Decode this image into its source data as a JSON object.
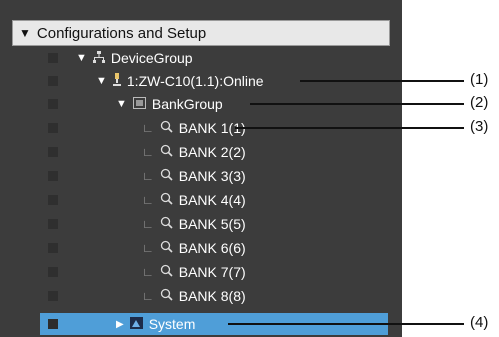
{
  "panel": {
    "header": "Configurations and Setup"
  },
  "tree": {
    "device_group": "DeviceGroup",
    "device": "1:ZW-C10(1.1):Online",
    "bank_group": "BankGroup",
    "banks": [
      "BANK 1(1)",
      "BANK 2(2)",
      "BANK 3(3)",
      "BANK 4(4)",
      "BANK 5(5)",
      "BANK 6(6)",
      "BANK 7(7)",
      "BANK 8(8)"
    ],
    "system": "System"
  },
  "callouts": [
    "(1)",
    "(2)",
    "(3)",
    "(4)"
  ],
  "colors": {
    "panel_bg": "#3c3c3c",
    "selected_row": "#4f9ed8",
    "header_bg": "#e8e8e8"
  }
}
